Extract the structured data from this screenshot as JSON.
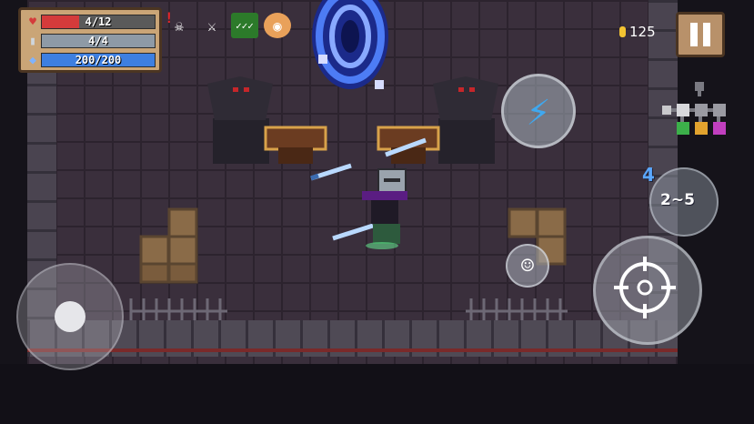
{
  "hud": {
    "health": {
      "icon": "heart-icon",
      "text": "4/12",
      "fraction": 0.333,
      "color": "#d43b3b"
    },
    "armor": {
      "icon": "shield-icon",
      "text": "4/4",
      "fraction": 1.0,
      "color": "#8e9aa6"
    },
    "energy": {
      "icon": "diamond-icon",
      "text": "200/200",
      "fraction": 1.0,
      "color": "#3e7fe0"
    },
    "alert_glyph": "!"
  },
  "buffs": [
    {
      "icon": "skull-creature-icon",
      "color": "#1b1820"
    },
    {
      "icon": "sword-hand-icon",
      "color": "#1b1820"
    },
    {
      "icon": "green-checks-icon",
      "color": "#2c7a2a"
    },
    {
      "icon": "helmet-face-icon",
      "color": "#1b1820"
    }
  ],
  "coins": {
    "icon": "coin-icon",
    "value": "125",
    "color": "#f3c332"
  },
  "pause": {
    "icon": "pause-icon"
  },
  "minimap": {
    "rooms": 6
  },
  "controls": {
    "skill": {
      "icon": "lightning-icon",
      "color": "#3fa8ef"
    },
    "attack": {
      "icon": "crosshair-icon"
    },
    "emote": {
      "icon": "smiley-icon"
    },
    "weapon": {
      "energy_cost": "4",
      "damage": "2~5",
      "icon": "swap-arrows-icon"
    }
  },
  "scene": {
    "portal_color": "#3a62e8",
    "player": {
      "icon": "knight-player-icon",
      "hat_color": "#5a1d82"
    }
  }
}
